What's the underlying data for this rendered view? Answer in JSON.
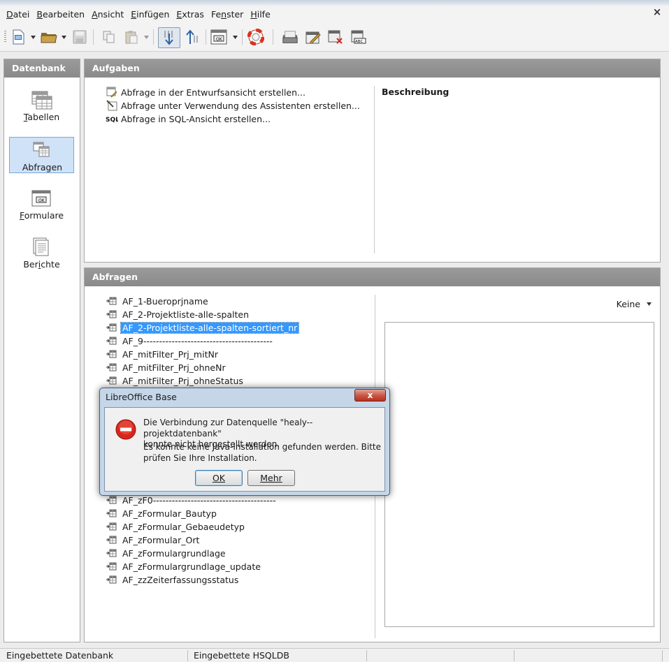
{
  "menubar": {
    "items": [
      {
        "label": "Datei",
        "acc": "D",
        "rest": "atei"
      },
      {
        "label": "Bearbeiten",
        "acc": "B",
        "rest": "earbeiten"
      },
      {
        "label": "Ansicht",
        "acc": "A",
        "rest": "nsicht"
      },
      {
        "label": "Einfügen",
        "acc": "E",
        "rest": "infügen"
      },
      {
        "label": "Extras",
        "acc": "E",
        "rest": "xtras"
      },
      {
        "label": "Fenster",
        "pre": "Fe",
        "acc": "n",
        "rest": "ster"
      },
      {
        "label": "Hilfe",
        "acc": "H",
        "rest": "ilfe"
      }
    ],
    "close": "×"
  },
  "sidebar": {
    "title": "Datenbank",
    "items": [
      {
        "label": "Tabellen",
        "acc": "T",
        "rest": "abellen",
        "icon": "table-icon"
      },
      {
        "label": "Abfragen",
        "acc": "",
        "rest": "Abfragen",
        "icon": "query-icon"
      },
      {
        "label": "Formulare",
        "acc": "F",
        "rest": "ormulare",
        "icon": "form-icon"
      },
      {
        "label": "Berichte",
        "pre": "Ber",
        "acc": "i",
        "rest": "chte",
        "icon": "report-icon"
      }
    ]
  },
  "tasks": {
    "title": "Aufgaben",
    "items": [
      "Abfrage in der Entwurfsansicht erstellen...",
      "Abfrage unter Verwendung des Assistenten erstellen...",
      "Abfrage in SQL-Ansicht erstellen..."
    ],
    "description_label": "Beschreibung"
  },
  "queries": {
    "title": "Abfragen",
    "items": [
      "AF_1-Bueroprjname",
      "AF_2-Projektliste-alle-spalten",
      "AF_2-Projektliste-alle-spalten-sortiert_nr",
      "AF_9-----------------------------------------",
      "AF_mitFilter_Prj_mitNr",
      "AF_mitFilter_Prj_ohneNr",
      "AF_mitFilter_Prj_ohneStatus",
      "AF_zF0---------------------------------------",
      "AF_zFormular_Bautyp",
      "AF_zFormular_Gebaeudetyp",
      "AF_zFormular_Ort",
      "AF_zFormulargrundlage",
      "AF_zFormulargrundlage_update",
      "AF_zzZeiterfassungsstatus"
    ],
    "selected_index": 2,
    "preview_option": "Keine"
  },
  "dialog": {
    "title": "LibreOffice Base",
    "close": "x",
    "message_line1": "Die Verbindung zur Datenquelle \"healy--projektdatenbank\"",
    "message_line2": "konnte nicht hergestellt werden.",
    "message_line3": "Es konnte keine Java-Installation gefunden werden. Bitte",
    "message_line4": "prüfen Sie Ihre Installation.",
    "ok_label": "OK",
    "more_label": "Mehr"
  },
  "statusbar": {
    "cell1": "Eingebettete Datenbank",
    "cell2": "Eingebettete HSQLDB"
  },
  "colors": {
    "panel_header": "#8f8f8f",
    "selection": "#3399ff",
    "sidebar_selected": "#cfe2f7",
    "error_red": "#d9261c"
  }
}
